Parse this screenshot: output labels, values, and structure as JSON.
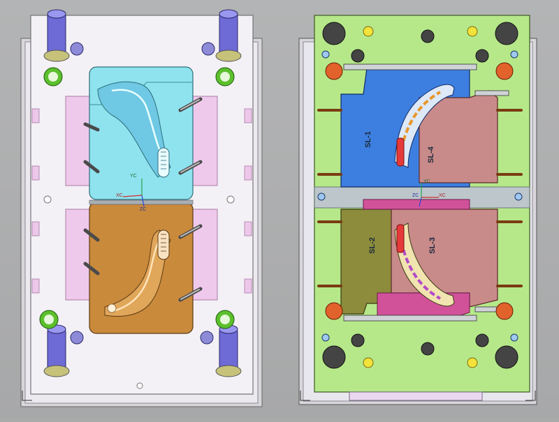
{
  "colors": {
    "background": "#aeafb0",
    "plate_white": "#f3f0f5",
    "plate_green": "#b6e88a",
    "cavity_cyan": "#8fe3ef",
    "cavity_orange": "#c98a3c",
    "slider_blue": "#3d7fe0",
    "slider_rose": "#c98a8a",
    "slider_olive": "#8c8c3c",
    "slider_magenta": "#d2529a"
  },
  "core_half": {
    "axes": {
      "x": "XC",
      "y": "YC",
      "z": "ZC"
    }
  },
  "cavity_half": {
    "sliders": [
      "SL-1",
      "SL-4",
      "SL-2",
      "SL-3"
    ],
    "axes": {
      "x": "XC",
      "y": "YC",
      "z": "ZC"
    }
  },
  "icons": [
    "guide-pin-icon",
    "bolt-icon",
    "wcs-triad-icon"
  ]
}
